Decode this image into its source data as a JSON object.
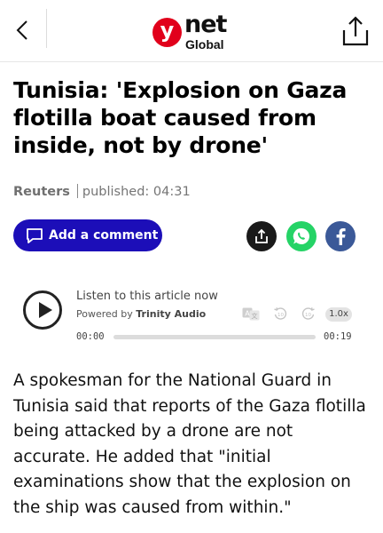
{
  "header": {
    "logo_y": "y",
    "logo_net": "net",
    "logo_global": "Global"
  },
  "article": {
    "headline": "Tunisia: 'Explosion on Gaza flotilla boat caused from inside, not by drone'",
    "source": "Reuters",
    "published": "published: 04:31",
    "comment_label": "Add a comment",
    "body": "A spokesman for the National Guard in Tunisia said that reports of the Gaza flotilla being attacked by a drone are not accurate. He added that \"initial examinations show that the explosion on the ship was caused from within.\""
  },
  "audio_player": {
    "listen_label": "Listen to this article now",
    "powered_prefix": "Powered by",
    "powered_brand": "Trinity Audio",
    "speed": "1.0x",
    "current_time": "00:00",
    "duration": "00:19",
    "progress_fraction": 0
  },
  "icons": {
    "back": "chevron-left-icon",
    "share": "share-icon",
    "comment": "speech-bubble-icon",
    "whatsapp": "whatsapp-icon",
    "facebook": "facebook-icon",
    "translate": "translate-icon",
    "rewind": "rewind-10-icon",
    "forward": "forward-10-icon"
  },
  "colors": {
    "brand_red": "#e1001b",
    "comment_button": "#1c0eb8",
    "whatsapp": "#25d366",
    "facebook": "#3b5998"
  }
}
